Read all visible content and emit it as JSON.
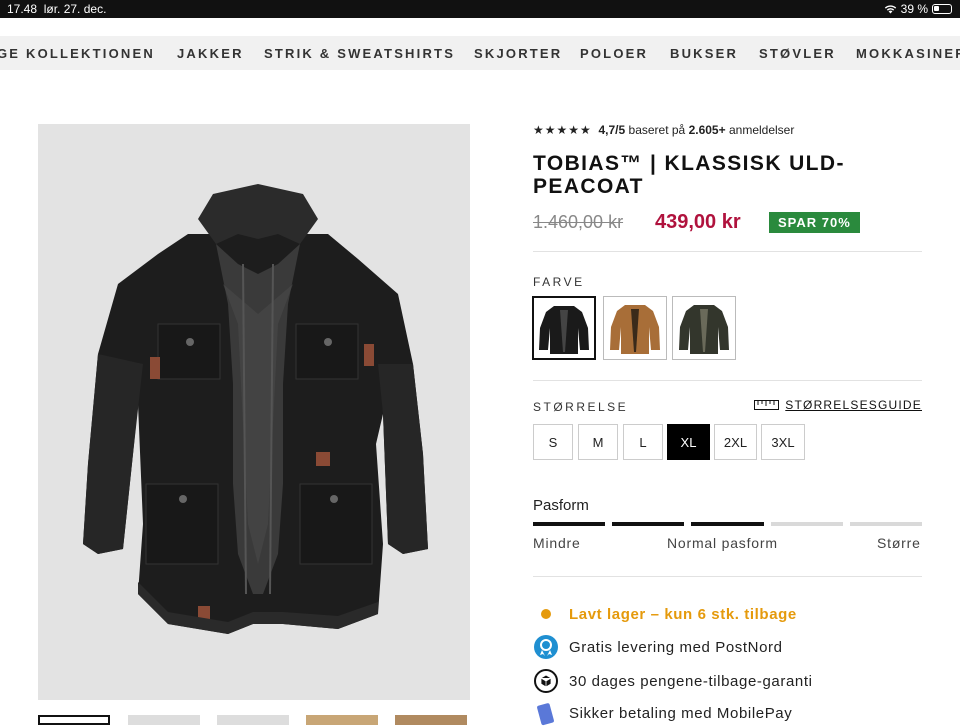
{
  "status": {
    "time": "17.48",
    "date": "lør. 27. dec.",
    "battery": "39 %"
  },
  "nav": {
    "items": [
      "GE KOLLEKTIONEN",
      "JAKKER",
      "STRIK & SWEATSHIRTS",
      "SKJORTER",
      "POLOER",
      "BUKSER",
      "STØVLER",
      "MOKKASINER"
    ]
  },
  "product": {
    "rating_stars": "★★★★★",
    "rating_value": "4,7/5",
    "rating_mid": "baseret på",
    "rating_count": "2.605+",
    "rating_suffix": "anmeldelser",
    "title": "TOBIAS™ | KLASSISK ULD-PEACOAT",
    "old_price": "1.460,00 kr",
    "new_price": "439,00 kr",
    "save_badge": "SPAR 70%"
  },
  "color": {
    "label": "FARVE",
    "swatches": [
      {
        "name": "Sort",
        "hex": "#1a1a1a"
      },
      {
        "name": "Brun",
        "hex": "#a86e38"
      },
      {
        "name": "Mørkegrøn",
        "hex": "#33362c"
      }
    ],
    "selected": 0
  },
  "size": {
    "label": "STØRRELSE",
    "guide": "STØRRELSESGUIDE",
    "options": [
      "S",
      "M",
      "L",
      "XL",
      "2XL",
      "3XL"
    ],
    "selected": "XL"
  },
  "fit": {
    "title": "Pasform",
    "left": "Mindre",
    "center": "Normal pasform",
    "right": "Større",
    "filled_segments": 3,
    "total_segments": 5
  },
  "features": {
    "stock": "Lavt lager – kun 6 stk. tilbage",
    "delivery": "Gratis levering med PostNord",
    "guarantee": "30 dages pengene-tilbage-garanti",
    "payment": "Sikker betaling med MobilePay"
  },
  "colors": {
    "price_red": "#b0123d",
    "save_green": "#2a8a3d",
    "stock_orange": "#e59a0c",
    "delivery_blue": "#1f8fd1"
  }
}
